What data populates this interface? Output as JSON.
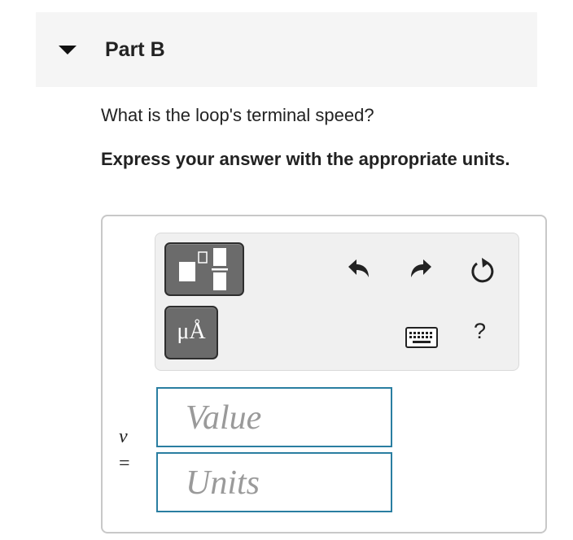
{
  "part": {
    "title": "Part B",
    "collapse_icon": "caret-down-icon"
  },
  "question": "What is the loop's terminal speed?",
  "instruction": "Express your answer with the appropriate units.",
  "toolbar": {
    "templates_icon": "templates-icon",
    "units_label": "μÅ",
    "undo_icon": "undo-icon",
    "redo_icon": "redo-icon",
    "reset_icon": "reset-icon",
    "keyboard_icon": "keyboard-icon",
    "help_label": "?"
  },
  "answer": {
    "variable": "v",
    "equals": "=",
    "value_placeholder": "Value",
    "units_placeholder": "Units"
  }
}
